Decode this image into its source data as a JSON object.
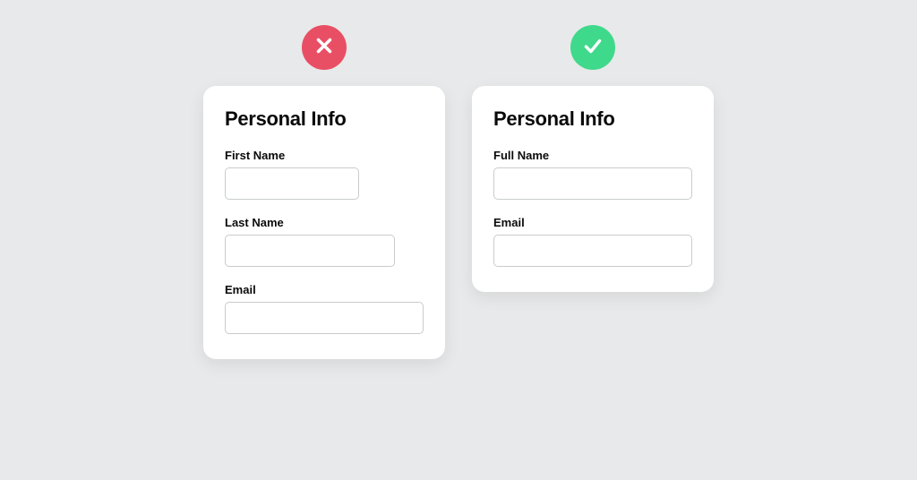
{
  "colors": {
    "bad": "#e94f64",
    "good": "#3fd98b"
  },
  "bad": {
    "title": "Personal Info",
    "fields": [
      {
        "label": "First Name",
        "width": "w-small"
      },
      {
        "label": "Last Name",
        "width": "w-medium"
      },
      {
        "label": "Email",
        "width": "w-large"
      }
    ]
  },
  "good": {
    "title": "Personal Info",
    "fields": [
      {
        "label": "Full Name",
        "width": "w-large"
      },
      {
        "label": "Email",
        "width": "w-large"
      }
    ]
  }
}
